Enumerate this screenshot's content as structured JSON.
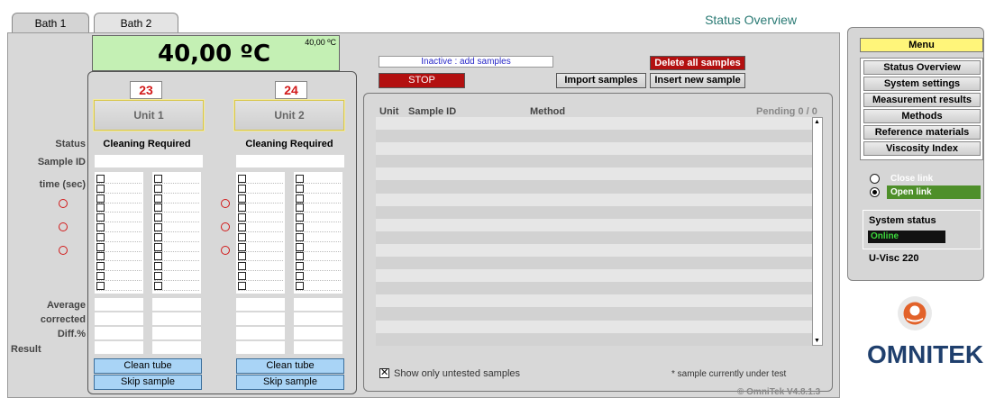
{
  "tabs": [
    {
      "label": "Bath 1",
      "active": true
    },
    {
      "label": "Bath 2",
      "active": false
    }
  ],
  "page_title": "Status Overview",
  "temperature": {
    "main": "40,00 ºC",
    "setpoint": "40,00 ºC"
  },
  "labels": {
    "status": "Status",
    "sample_id": "Sample ID",
    "time": "time (sec)",
    "average": "Average",
    "corrected": "corrected",
    "diff": "Diff.%",
    "result": "Result"
  },
  "units": [
    {
      "number": "23",
      "name": "Unit 1",
      "status": "Cleaning Required",
      "clean_btn": "Clean tube",
      "skip_btn": "Skip sample"
    },
    {
      "number": "24",
      "name": "Unit 2",
      "status": "Cleaning Required",
      "clean_btn": "Clean tube",
      "skip_btn": "Skip sample"
    }
  ],
  "queue": {
    "status_text": "Inactive : add samples",
    "stop_btn": "STOP",
    "delete_btn": "Delete all samples",
    "import_btn": "Import samples",
    "insert_btn": "Insert new sample",
    "columns": {
      "unit": "Unit",
      "sample_id": "Sample ID",
      "method": "Method",
      "pending": "Pending 0 / 0"
    },
    "filter_label": "Show only untested samples",
    "filter_checked": true,
    "footnote": "* sample currently under test"
  },
  "menu": {
    "title": "Menu",
    "items": [
      "Status Overview",
      "System settings",
      "Measurement results",
      "Methods",
      "Reference materials",
      "Viscosity Index"
    ],
    "close_link": "Close link",
    "open_link": "Open link",
    "system_status_label": "System status",
    "system_status_value": "Online",
    "device": "U-Visc 220"
  },
  "brand": "OMNITEK",
  "version": "© OmniTek V4.8.1.3",
  "colors": {
    "accent_green": "#c4f0b4",
    "stop_red": "#b31010",
    "menu_yellow": "#fff57a",
    "link_green": "#4e8f2a",
    "title_teal": "#2a7a74",
    "unit_number_red": "#d21a1a",
    "logo_orange": "#e2622a"
  }
}
